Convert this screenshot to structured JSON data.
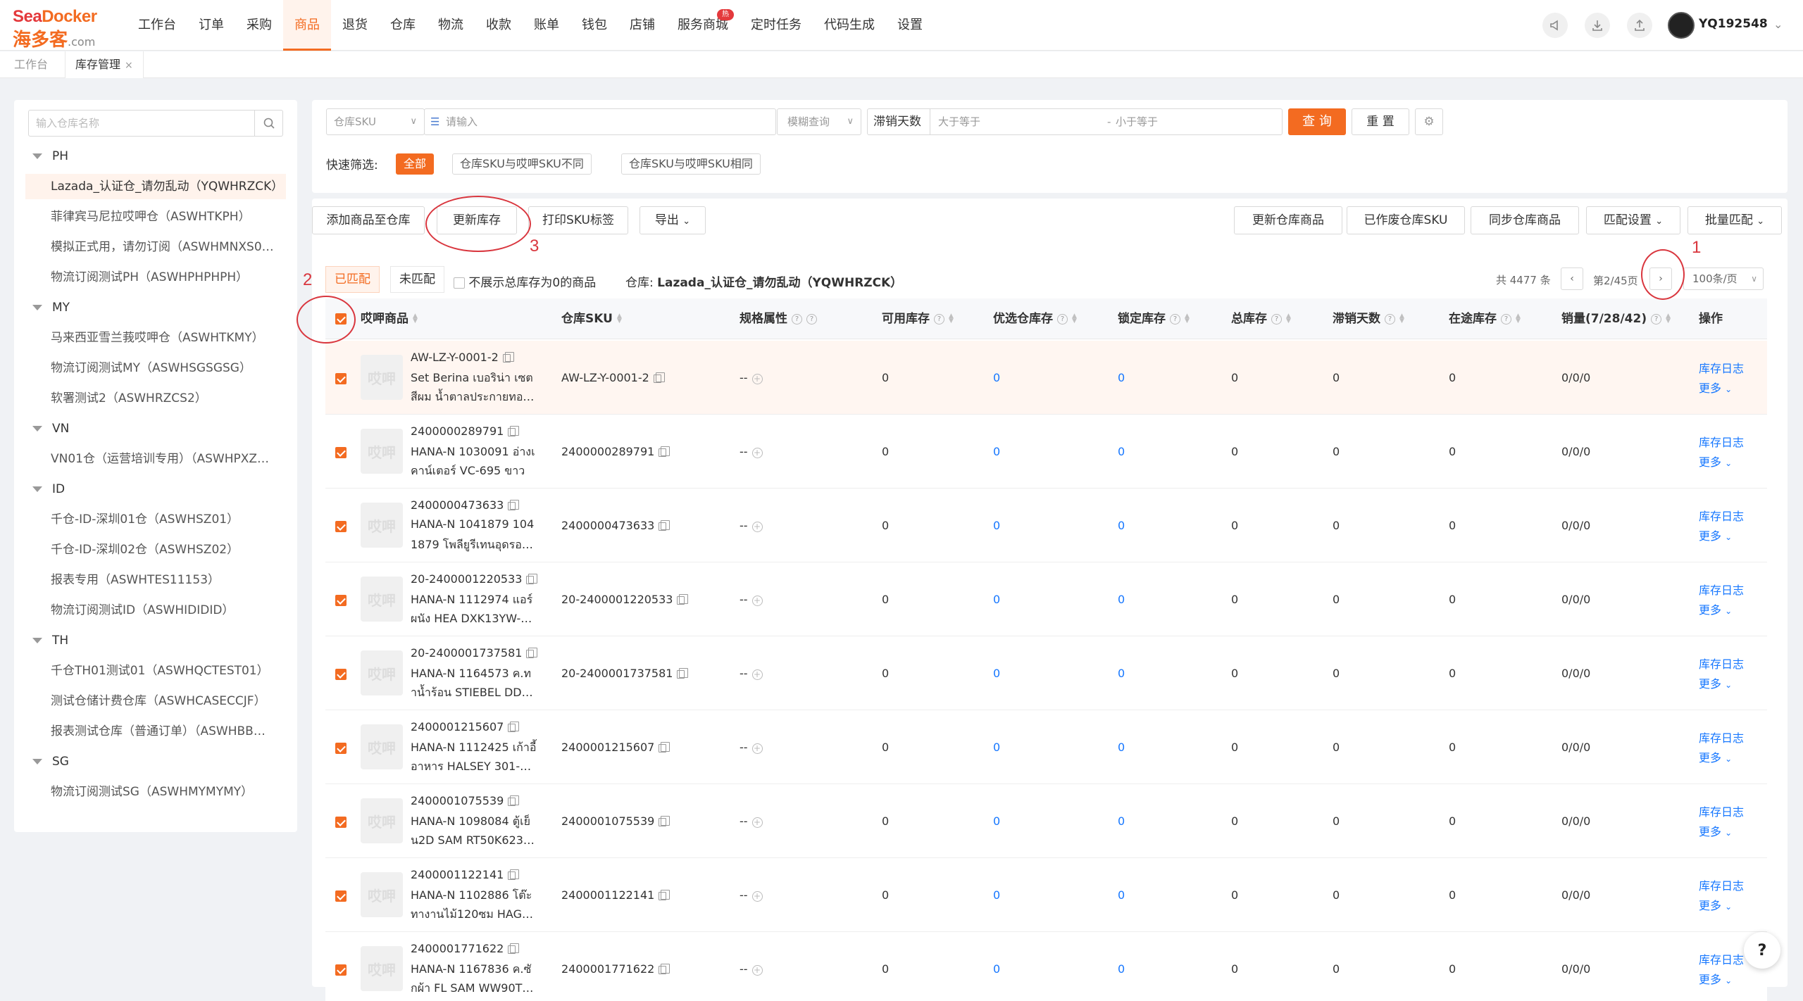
{
  "brand": {
    "line1_a": "Sea",
    "line1_b": "Docker",
    "line2_main": "海多客",
    "line2_suffix": ".com"
  },
  "nav": {
    "items": [
      "工作台",
      "订单",
      "采购",
      "商品",
      "退货",
      "仓库",
      "物流",
      "收款",
      "账单",
      "钱包",
      "店铺",
      "服务商城",
      "定时任务",
      "代码生成",
      "设置"
    ],
    "active": "商品",
    "badge": "热"
  },
  "user": {
    "name": "YQ192548"
  },
  "tabs": [
    {
      "label": "工作台"
    },
    {
      "label": "库存管理",
      "close": "×"
    }
  ],
  "sidebar": {
    "search_placeholder": "输入仓库名称",
    "groups": [
      {
        "name": "PH",
        "items": [
          "Lazada_认证仓_请勿乱动（YQWHRZCK）",
          "菲律宾马尼拉哎呷仓（ASWHTKPH）",
          "模拟正式用，请勿订阅（ASWHMNXS0…",
          "物流订阅测试PH（ASWHPHPHPH）"
        ]
      },
      {
        "name": "MY",
        "items": [
          "马来西亚雪兰莪哎呷仓（ASWHTKMY）",
          "物流订阅测试MY（ASWHSGSGSG）",
          "软署测试2（ASWHRZCS2）"
        ]
      },
      {
        "name": "VN",
        "items": [
          "VN01仓（运营培训专用）（ASWHPXZ…"
        ]
      },
      {
        "name": "ID",
        "items": [
          "千仓-ID-深圳01仓（ASWHSZ01）",
          "千仓-ID-深圳02仓（ASWHSZ02）",
          "报表专用（ASWHTES11153）",
          "物流订阅测试ID（ASWHIDIDID）"
        ]
      },
      {
        "name": "TH",
        "items": [
          "千仓TH01测试01（ASWHQCTEST01）",
          "测试仓储计费仓库（ASWHCASECCJF）",
          "报表测试仓库（普通订单）（ASWHBB…"
        ]
      },
      {
        "name": "SG",
        "items": [
          "物流订阅测试SG（ASWHMYMYMY）"
        ]
      }
    ],
    "selected": "Lazada_认证仓_请勿乱动（YQWHRZCK）"
  },
  "filters": {
    "sku_type": "仓库SKU",
    "input_placeholder": "请输入",
    "match_mode": "模糊查询",
    "stagnant_label": "滞销天数",
    "min_placeholder": "大于等于",
    "range_sep": "-",
    "max_placeholder": "小于等于",
    "query": "查 询",
    "reset": "重 置",
    "quick_label": "快速筛选:",
    "quick_tags": [
      "全部",
      "仓库SKU与哎呷SKU不同",
      "仓库SKU与哎呷SKU相同"
    ]
  },
  "toolbar": {
    "left": [
      "添加商品至仓库",
      "更新库存",
      "打印SKU标签",
      "导出"
    ],
    "right": [
      "更新仓库商品",
      "已作废仓库SKU",
      "同步仓库商品",
      "匹配设置",
      "批量匹配"
    ]
  },
  "subtabs": {
    "matched": "已匹配",
    "unmatched": "未匹配",
    "hide_zero": "不展示总库存为0的商品",
    "warehouse_prefix": "仓库:",
    "warehouse_name": "Lazada_认证仓_请勿乱动（YQWHRZCK）"
  },
  "pager": {
    "total": "共 4477 条",
    "page": "第2/45页",
    "page_size": "100条/页"
  },
  "columns": [
    "哎呷商品",
    "仓库SKU",
    "规格属性",
    "可用库存",
    "优选仓库存",
    "锁定库存",
    "总库存",
    "滞销天数",
    "在途库存",
    "销量(7/28/42)",
    "操作"
  ],
  "thumb_text": "哎呷",
  "rows": [
    {
      "id": "AW-LZ-Y-0001-2",
      "name1": "Set Berina เบอริน่า เซต",
      "name2": "สีผม น้ำตาลประกายทอ…",
      "sku": "AW-LZ-Y-0001-2",
      "spec": "--",
      "avail": "0",
      "pref": "0",
      "lock": "0",
      "total": "0",
      "stag": "0",
      "transit": "0",
      "sales": "0/0/0",
      "highlight": true
    },
    {
      "id": "2400000289791",
      "name1": "HANA-N 1030091 อ่างเ",
      "name2": "คาน์เตอร์ VC-695 ขาว",
      "sku": "2400000289791",
      "spec": "--",
      "avail": "0",
      "pref": "0",
      "lock": "0",
      "total": "0",
      "stag": "0",
      "transit": "0",
      "sales": "0/0/0"
    },
    {
      "id": "2400000473633",
      "name1": "HANA-N 1041879 104",
      "name2": "1879 โพลียูรีเทนอุดรอ…",
      "sku": "2400000473633",
      "spec": "--",
      "avail": "0",
      "pref": "0",
      "lock": "0",
      "total": "0",
      "stag": "0",
      "transit": "0",
      "sales": "0/0/0"
    },
    {
      "id": "20-2400001220533",
      "name1": "HANA-N 1112974 แอร์",
      "name2": "ผนัง HEA DXK13YW-…",
      "sku": "20-2400001220533",
      "spec": "--",
      "avail": "0",
      "pref": "0",
      "lock": "0",
      "total": "0",
      "stag": "0",
      "transit": "0",
      "sales": "0/0/0"
    },
    {
      "id": "20-2400001737581",
      "name1": "HANA-N 1164573 ค.ท",
      "name2": "าน้ำร้อน STIEBEL DD…",
      "sku": "20-2400001737581",
      "spec": "--",
      "avail": "0",
      "pref": "0",
      "lock": "0",
      "total": "0",
      "stag": "0",
      "transit": "0",
      "sales": "0/0/0"
    },
    {
      "id": "2400001215607",
      "name1": "HANA-N 1112425 เก้าอี้",
      "name2": "อาหาร HALSEY 301-…",
      "sku": "2400001215607",
      "spec": "--",
      "avail": "0",
      "pref": "0",
      "lock": "0",
      "total": "0",
      "stag": "0",
      "transit": "0",
      "sales": "0/0/0"
    },
    {
      "id": "2400001075539",
      "name1": "HANA-N 1098084 ตู้เย็",
      "name2": "น2D SAM RT50K623…",
      "sku": "2400001075539",
      "spec": "--",
      "avail": "0",
      "pref": "0",
      "lock": "0",
      "total": "0",
      "stag": "0",
      "transit": "0",
      "sales": "0/0/0"
    },
    {
      "id": "2400001122141",
      "name1": "HANA-N 1102886 โต๊ะ",
      "name2": "ทางานไม้120ซม HAG…",
      "sku": "2400001122141",
      "spec": "--",
      "avail": "0",
      "pref": "0",
      "lock": "0",
      "total": "0",
      "stag": "0",
      "transit": "0",
      "sales": "0/0/0"
    },
    {
      "id": "2400001771622",
      "name1": "HANA-N 1167836 ค.ซั",
      "name2": "กผ้า FL SAM WW90T…",
      "sku": "2400001771622",
      "spec": "--",
      "avail": "0",
      "pref": "0",
      "lock": "0",
      "total": "0",
      "stag": "0",
      "transit": "0",
      "sales": "0/0/0"
    }
  ],
  "row_actions": {
    "log": "库存日志",
    "more": "更多"
  },
  "annotations": [
    "1",
    "2",
    "3"
  ],
  "help": "?",
  "colors": {
    "accent": "#f36b21",
    "link": "#1677ff",
    "annotation": "#d9363e"
  }
}
